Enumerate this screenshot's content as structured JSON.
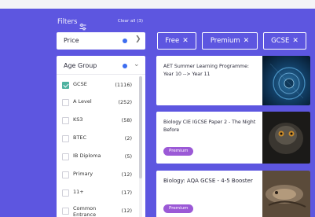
{
  "filters": {
    "title": "Filters",
    "clear_all": "Clear all (3)"
  },
  "price": {
    "label": "Price"
  },
  "age_group": {
    "label": "Age Group",
    "options": [
      {
        "name": "GCSE",
        "count": "(1116)",
        "checked": true
      },
      {
        "name": "A Level",
        "count": "(252)",
        "checked": false
      },
      {
        "name": "KS3",
        "count": "(58)",
        "checked": false
      },
      {
        "name": "BTEC",
        "count": "(2)",
        "checked": false
      },
      {
        "name": "IB Diploma",
        "count": "(5)",
        "checked": false
      },
      {
        "name": "Primary",
        "count": "(12)",
        "checked": false
      },
      {
        "name": "11+",
        "count": "(17)",
        "checked": false
      },
      {
        "name": "Common Entrance",
        "count": "(12)",
        "checked": false
      }
    ]
  },
  "chips": [
    {
      "label": "Free"
    },
    {
      "label": "Premium"
    },
    {
      "label": "GCSE"
    }
  ],
  "cards": [
    {
      "title": "AET Summer Learning Programme: Year 10 --> Year 11",
      "badge": ""
    },
    {
      "title": "Biology CIE IGCSE Paper 2 - The Night Before",
      "badge": "Premium"
    },
    {
      "title": "Biology: AQA GCSE - 4-5 Booster",
      "badge": "Premium"
    }
  ],
  "colors": {
    "background": "#5d56e0",
    "accent_dot": "#3d6df0",
    "checkbox_checked": "#4fb2a0",
    "badge": "#9b59d6"
  }
}
